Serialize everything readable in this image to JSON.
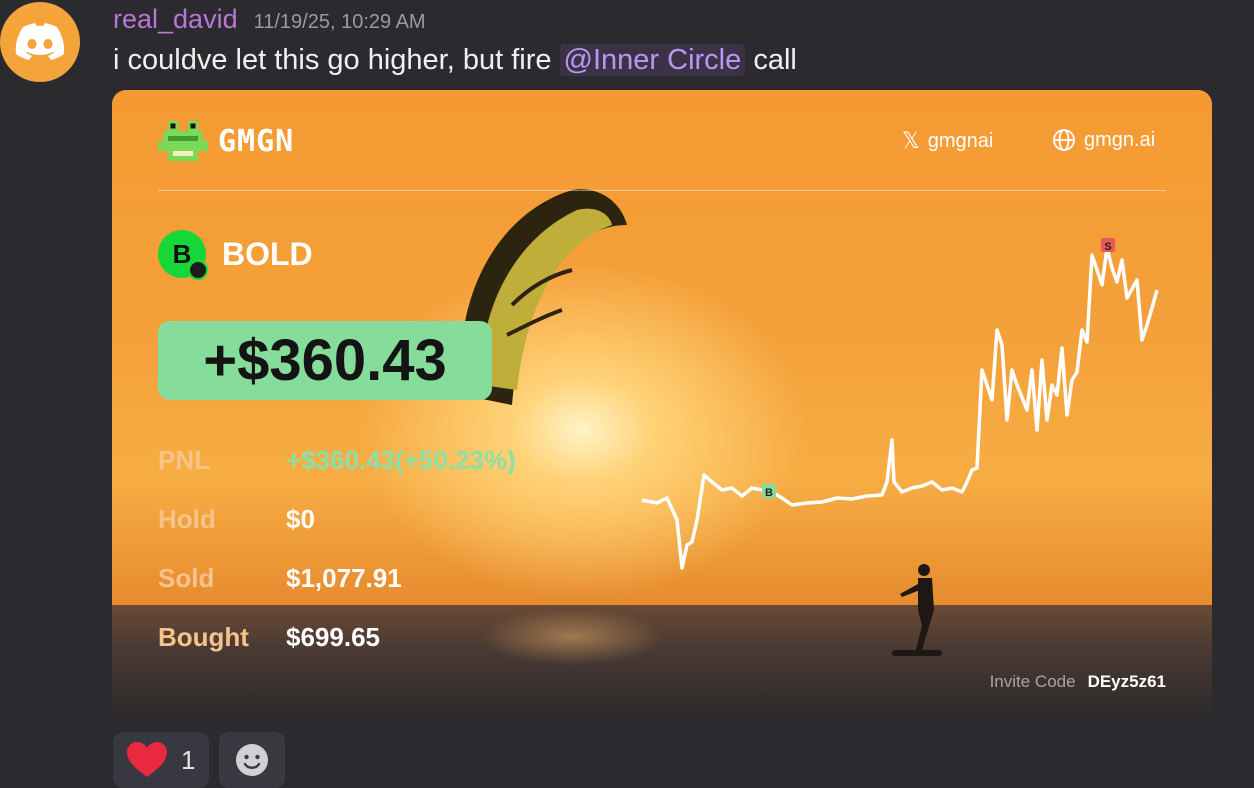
{
  "message": {
    "username": "real_david",
    "timestamp": "11/19/25, 10:29 AM",
    "text_before": "i couldve let this go higher, but fire ",
    "mention": "@Inner Circle",
    "text_after": " call",
    "avatar_icon": "discord-logo-icon",
    "avatar_color": "#f4a43a",
    "username_color": "#b777d6"
  },
  "card": {
    "brand": "GMGN",
    "social_x": "gmgnai",
    "website": "gmgn.ai",
    "token": {
      "symbol_letter": "B",
      "name": "BOLD"
    },
    "pnl_big": "+$360.43",
    "stats": [
      {
        "label": "PNL",
        "value": "+$360.43(+50.23%)"
      },
      {
        "label": "Hold",
        "value": "$0"
      },
      {
        "label": "Sold",
        "value": "$1,077.91"
      },
      {
        "label": "Bought",
        "value": "$699.65"
      }
    ],
    "invite_label": "Invite Code",
    "invite_code": "DEyz5z61",
    "chart_markers": {
      "buy": "B",
      "sell": "S"
    },
    "accent_green": "#86dd9b"
  },
  "reactions": [
    {
      "icon": "heart-icon",
      "count": "1"
    },
    {
      "icon": "add-reaction-icon"
    }
  ]
}
